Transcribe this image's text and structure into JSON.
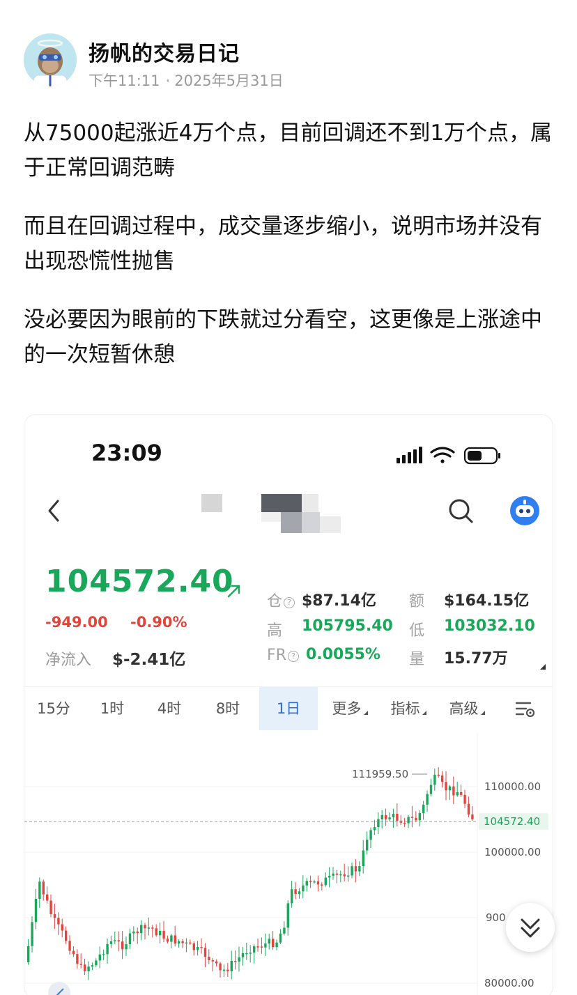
{
  "post": {
    "author": "扬帆的交易日记",
    "time": "下午11:11",
    "date": "2025年5月31日",
    "paragraphs": [
      "从75000起涨近4万个点，目前回调还不到1万个点，属于正常回调范畴",
      "而且在回调过程中，成交量逐步缩小，说明市场并没有出现恐慌性抛售",
      "没必要因为眼前的下跌就过分看空，这更像是上涨途中的一次短暂休憩"
    ]
  },
  "screenshot": {
    "status_time": "23:09",
    "price": "104572.40",
    "change_abs": "-949.00",
    "change_pct": "-0.90%",
    "net_inflow_label": "净流入",
    "net_inflow_value": "$-2.41亿",
    "stats": {
      "oi_label": "仓",
      "oi_value": "$87.14亿",
      "amount_label": "额",
      "amount_value": "$164.15亿",
      "high_label": "高",
      "high_value": "105795.40",
      "low_label": "低",
      "low_value": "103032.10",
      "fr_label": "FR",
      "fr_value": "0.0055%",
      "vol_label": "量",
      "vol_value": "15.77万"
    },
    "tabs": [
      "15分",
      "1时",
      "4时",
      "8时",
      "1日",
      "更多",
      "指标",
      "高级"
    ],
    "active_tab": "1日",
    "colors": {
      "up": "#19a85a",
      "down": "#e2453c",
      "active_tab": "#2d6fd1"
    }
  },
  "chart_data": {
    "type": "candlestick",
    "y_ticks": [
      "110000.00",
      "100000.00",
      "900",
      "80000.00"
    ],
    "current_price_tag": "104572.40",
    "high_label": "111959.50",
    "grid": true
  }
}
